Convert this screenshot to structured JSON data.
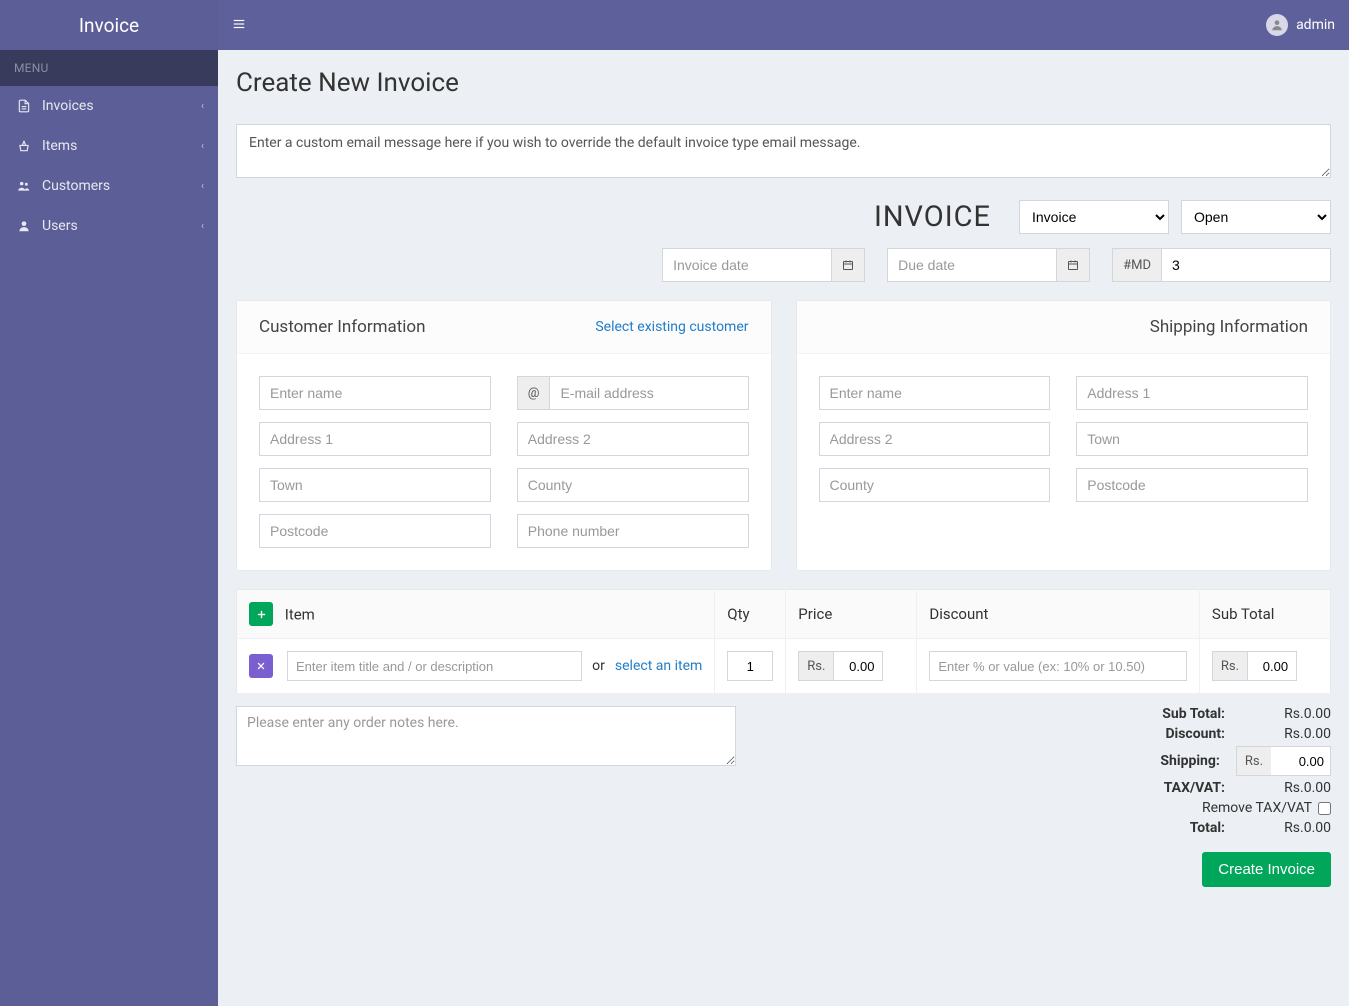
{
  "brand": "Invoice",
  "sidebar": {
    "menu_header": "MENU",
    "items": [
      {
        "icon": "file-text",
        "label": "Invoices"
      },
      {
        "icon": "basket",
        "label": "Items"
      },
      {
        "icon": "users",
        "label": "Customers"
      },
      {
        "icon": "user",
        "label": "Users"
      }
    ]
  },
  "topbar": {
    "user": "admin"
  },
  "page": {
    "title": "Create New Invoice",
    "email_placeholder": "Enter a custom email message here if you wish to override the default invoice type email message.",
    "invoice_head": "INVOICE",
    "type_select": "Invoice",
    "status_select": "Open",
    "invoice_date_placeholder": "Invoice date",
    "due_date_placeholder": "Due date",
    "id_prefix": "#MD",
    "id_value": "3"
  },
  "customer_panel": {
    "title": "Customer Information",
    "link": "Select existing customer",
    "fields": {
      "name": "Enter name",
      "email": "E-mail address",
      "at": "@",
      "address1": "Address 1",
      "address2": "Address 2",
      "town": "Town",
      "county": "County",
      "postcode": "Postcode",
      "phone": "Phone number"
    }
  },
  "shipping_panel": {
    "title": "Shipping Information",
    "fields": {
      "name": "Enter name",
      "address1": "Address 1",
      "address2": "Address 2",
      "town": "Town",
      "county": "County",
      "postcode": "Postcode"
    }
  },
  "table": {
    "headers": {
      "item": "Item",
      "qty": "Qty",
      "price": "Price",
      "discount": "Discount",
      "subtotal": "Sub Total"
    },
    "row": {
      "item_placeholder": "Enter item title and / or description",
      "or": "or",
      "select_item": "select an item",
      "qty_value": "1",
      "currency": "Rs.",
      "price_value": "0.00",
      "discount_placeholder": "Enter % or value (ex: 10% or 10.50)",
      "subtotal_value": "0.00"
    }
  },
  "notes_placeholder": "Please enter any order notes here.",
  "totals": {
    "subtotal_label": "Sub Total:",
    "subtotal_value": "Rs.0.00",
    "discount_label": "Discount:",
    "discount_value": "Rs.0.00",
    "shipping_label": "Shipping:",
    "shipping_prefix": "Rs.",
    "shipping_value": "0.00",
    "taxvat_label": "TAX/VAT:",
    "taxvat_value": "Rs.0.00",
    "remove_taxvat": "Remove TAX/VAT",
    "total_label": "Total:",
    "total_value": "Rs.0.00"
  },
  "create_button": "Create Invoice"
}
